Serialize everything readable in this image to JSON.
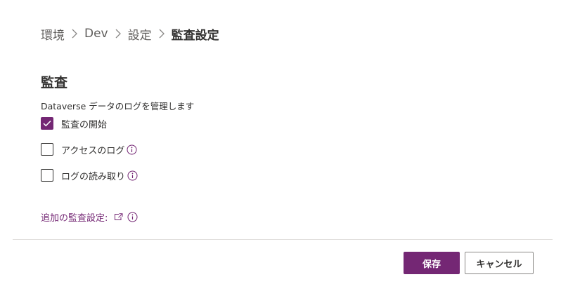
{
  "breadcrumb": {
    "items": [
      {
        "label": "環境"
      },
      {
        "label": "Dev"
      },
      {
        "label": "設定"
      }
    ],
    "current": "監査設定",
    "separator_icon": "chevron-right-icon"
  },
  "audit": {
    "title": "監査",
    "description": "Dataverse データのログを管理します",
    "options": [
      {
        "label": "監査の開始",
        "checked": true,
        "has_info": false
      },
      {
        "label": "アクセスのログ",
        "checked": false,
        "has_info": true
      },
      {
        "label": "ログの読み取り",
        "checked": false,
        "has_info": true
      }
    ],
    "more_link": "追加の監査設定:",
    "more_link_icon": "open-in-new-window-icon",
    "info_icon": "info-icon"
  },
  "footer": {
    "save_label": "保存",
    "cancel_label": "キャンセル"
  },
  "colors": {
    "accent": "#742774",
    "text": "#323130",
    "muted": "#605e5c",
    "divider": "#e1dfdd"
  }
}
